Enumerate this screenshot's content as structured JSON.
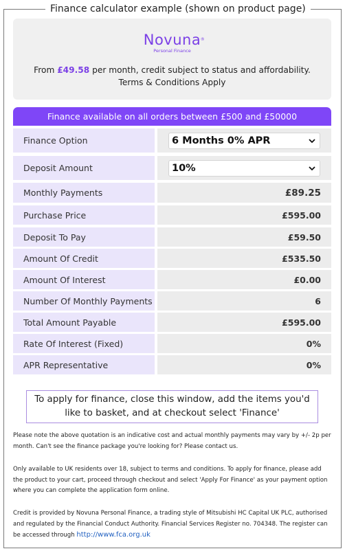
{
  "legend": "Finance calculator example (shown on product page)",
  "brand": {
    "name": "Novuna",
    "subtitle": "Personal Finance",
    "from_prefix": "From",
    "from_price": "£49.58",
    "from_suffix": "per month, credit subject to status and affordability. Terms & Conditions Apply"
  },
  "table_header": "Finance available on all orders between £500 and £50000",
  "finance_option": {
    "label": "Finance Option",
    "selected": "6 Months 0% APR"
  },
  "deposit_amount": {
    "label": "Deposit Amount",
    "selected": "10%"
  },
  "rows": [
    {
      "label": "Monthly Payments",
      "value": "£89.25"
    },
    {
      "label": "Purchase Price",
      "value": "£595.00"
    },
    {
      "label": "Deposit To Pay",
      "value": "£59.50"
    },
    {
      "label": "Amount Of Credit",
      "value": "£535.50"
    },
    {
      "label": "Amount Of Interest",
      "value": "£0.00"
    },
    {
      "label": "Number Of Monthly Payments",
      "value": "6"
    },
    {
      "label": "Total Amount Payable",
      "value": "£595.00"
    },
    {
      "label": "Rate Of Interest (Fixed)",
      "value": "0%"
    },
    {
      "label": "APR Representative",
      "value": "0%"
    }
  ],
  "apply_note": "To apply for finance, close this window, add the items you'd like to basket, and at checkout select 'Finance'",
  "disclaimer_1": "Please note the above quotation is an indicative cost and actual monthly payments may vary by +/- 2p per month. Can't see the finance package you're looking for? Please contact us.",
  "disclaimer_2": "Only available to UK residents over 18, subject to terms and conditions. To apply for finance, please add the product to your cart, proceed through checkout and select 'Apply For Finance' as your payment option where you can complete the application form online.",
  "disclaimer_3": "Credit is provided by Novuna Personal Finance, a trading style of Mitsubishi HC Capital UK PLC, authorised and regulated by the Financial Conduct Authority. Financial Services Register no. 704348. The register can be accessed through",
  "fca_link": "http://www.fca.org.uk",
  "colors": {
    "accent": "#7f46f7",
    "label_bg": "#eae5fb",
    "value_bg": "#ececec"
  }
}
